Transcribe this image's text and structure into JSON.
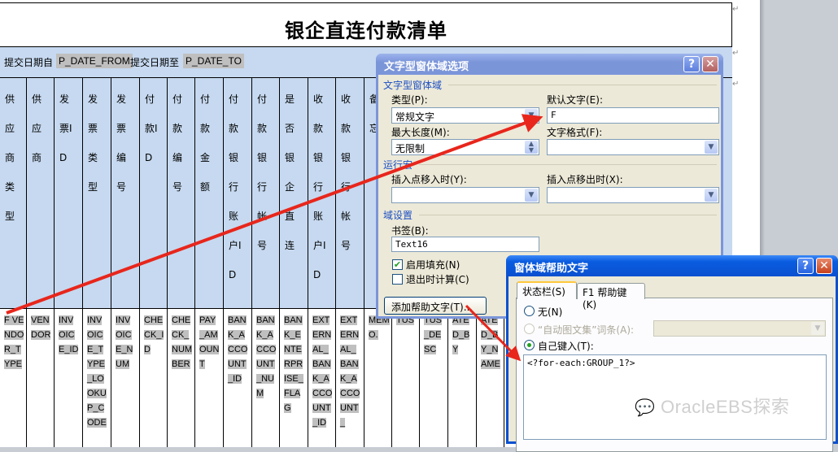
{
  "document": {
    "title": "银企直连付款清单",
    "date_from_label": "提交日期自",
    "date_from_field": "P_DATE_FROM",
    "date_to_label": "提交日期至",
    "date_to_field": "P_DATE_TO",
    "columns": [
      {
        "header": "供应商类型",
        "field": "F VENDOR_TYPE"
      },
      {
        "header": "供应商",
        "field": "VENDOR"
      },
      {
        "header": "发票ID",
        "field": "INVOICE_ID"
      },
      {
        "header": "发票类型",
        "field": "INVOICE_TYPE_LOOKUP_CODE"
      },
      {
        "header": "发票编号",
        "field": "INVOICE_NUM"
      },
      {
        "header": "付款ID",
        "field": "CHECK_ID"
      },
      {
        "header": "付款编号",
        "field": "CHECK_NUMBER"
      },
      {
        "header": "付款金额",
        "field": "PAY_AMOUNT"
      },
      {
        "header": "付款银行账户ID",
        "field": "BANK_ACCOUNT_ID"
      },
      {
        "header": "付款银行帐号",
        "field": "BANK_ACCOUNT_NUM"
      },
      {
        "header": "是否银企直连",
        "field": "BANK_ENTERPRISE_FLAG"
      },
      {
        "header": "收款银行账户ID",
        "field": "EXTERNAL_BANK_ACCOUNT_ID"
      },
      {
        "header": "收款银行帐号",
        "field": "EXTERNAL_BANK_ACCOUNT_"
      },
      {
        "header": "备忘",
        "field": "MEMO."
      }
    ],
    "extra_data_fields": [
      "TUS",
      "TUS_DESC",
      "ATED_BY",
      "ATED_BY_NAME"
    ]
  },
  "dialog_textfield": {
    "title": "文字型窗体域选项",
    "section_field": "文字型窗体域",
    "type_label": "类型(P):",
    "type_value": "常规文字",
    "default_text_label": "默认文字(E):",
    "default_text_value": "F",
    "max_length_label": "最大长度(M):",
    "max_length_value": "无限制",
    "text_format_label": "文字格式(F):",
    "text_format_value": "",
    "section_macro": "运行宏",
    "on_entry_label": "插入点移入时(Y):",
    "on_exit_label": "插入点移出时(X):",
    "section_settings": "域设置",
    "bookmark_label": "书签(B):",
    "bookmark_value": "Text16",
    "fill_in_enabled_label": "启用填充(N)",
    "fill_in_enabled": true,
    "calc_on_exit_label": "退出时计算(C)",
    "calc_on_exit": false,
    "add_help_text_button": "添加帮助文字(T)...",
    "help_glyph": "?",
    "close_glyph": "✕"
  },
  "dialog_helptext": {
    "title": "窗体域帮助文字",
    "tabs": [
      {
        "label": "状态栏(S)",
        "active": true
      },
      {
        "label": "F1 帮助键(K)",
        "active": false
      }
    ],
    "option_none": "无(N)",
    "option_autotext": "“自动图文集”词条(A):",
    "option_custom": "自己键入(T):",
    "selected_option": "custom",
    "custom_text": "<?for-each:GROUP_1?>",
    "help_glyph": "?",
    "close_glyph": "✕"
  },
  "watermark": "OracleEBS探索",
  "annotation_color": "#e8261c"
}
